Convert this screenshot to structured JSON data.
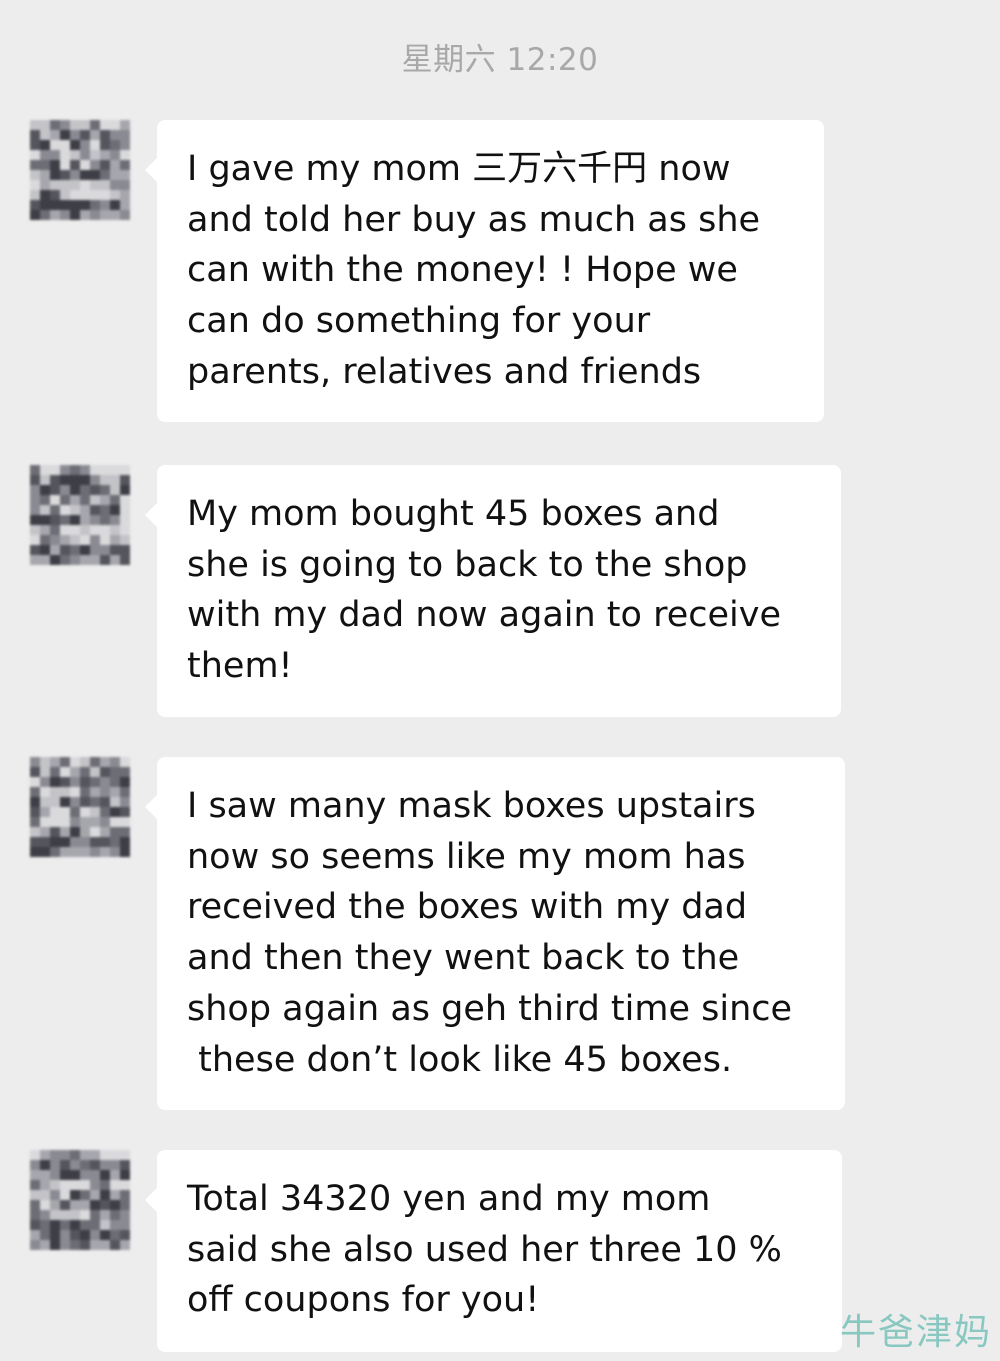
{
  "chat": {
    "timestamp": "星期六 12:20",
    "messages": [
      {
        "text": "I gave my mom 三万六千円 now\nand told her buy as much as she\ncan with the money! ! Hope we\ncan do something for your\nparents, relatives and friends",
        "avatar_icon": "blurred-user-avatar-icon"
      },
      {
        "text": "My mom bought 45 boxes and\nshe is going to back to the shop\nwith my dad now again to receive\nthem!",
        "avatar_icon": "blurred-user-avatar-icon"
      },
      {
        "text": "I saw many mask boxes upstairs\nnow so seems like my mom has\nreceived the boxes with my dad\nand then they went back to the\nshop again as geh third time since\n these don’t look like 45 boxes.",
        "avatar_icon": "blurred-user-avatar-icon"
      },
      {
        "text": "Total 34320 yen and my mom\nsaid she also used her three 10 %\noff coupons for you!",
        "avatar_icon": "blurred-user-avatar-icon"
      }
    ]
  },
  "watermark": "牛爸津妈",
  "colors": {
    "background": "#ededed",
    "bubble": "#ffffff",
    "text": "#111111",
    "timestamp": "#a8a8a8",
    "watermark": "#7fc3bd"
  }
}
